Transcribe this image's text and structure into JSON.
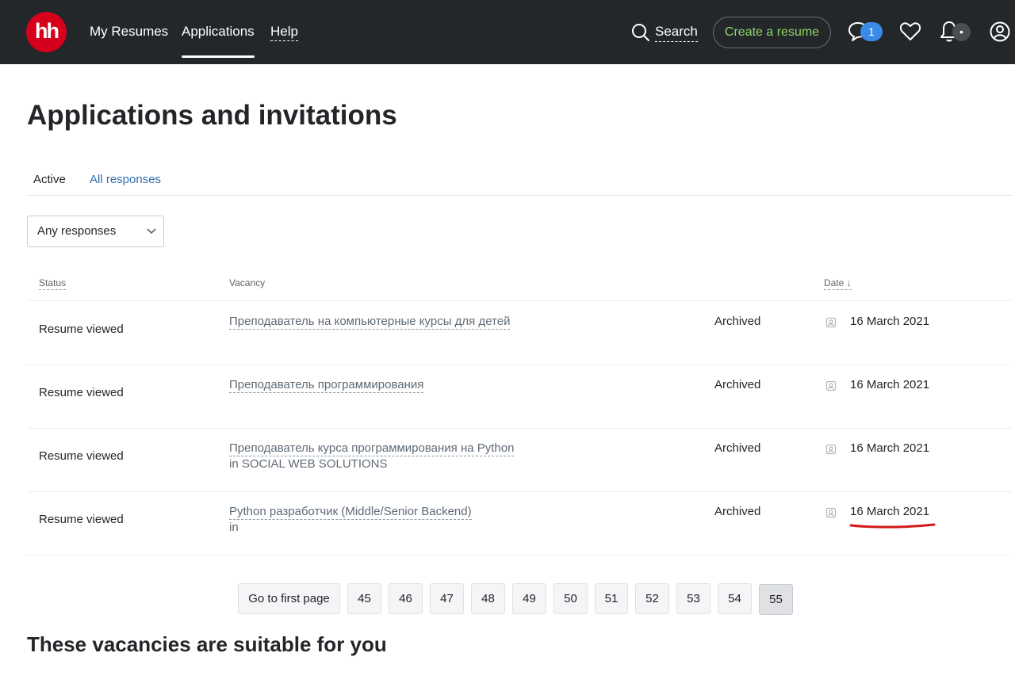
{
  "header": {
    "logo_text": "hh",
    "nav": [
      "My Resumes",
      "Applications",
      "Help"
    ],
    "search_label": "Search",
    "create_resume_label": "Create a resume",
    "messages_badge": "1",
    "notifications_badge": "•",
    "brand_color": "#d6001c",
    "accent_green": "#8fd66a"
  },
  "page_title": "Applications and invitations",
  "tabs": [
    "Active",
    "All responses"
  ],
  "filter": {
    "selected": "Any responses"
  },
  "table": {
    "headers": {
      "status": "Status",
      "vacancy": "Vacancy",
      "date": "Date ↓"
    },
    "rows": [
      {
        "status": "Resume viewed",
        "vacancy": "Преподаватель на компьютерные курсы для детей",
        "company": "",
        "state": "Archived",
        "date": "16 March 2021"
      },
      {
        "status": "Resume viewed",
        "vacancy": "Преподаватель программирования",
        "company": "",
        "state": "Archived",
        "date": "16 March 2021"
      },
      {
        "status": "Resume viewed",
        "vacancy": "Преподаватель курса программирования на Python",
        "company": "in SOCIAL WEB SOLUTIONS",
        "state": "Archived",
        "date": "16 March 2021"
      },
      {
        "status": "Resume viewed",
        "vacancy": "Python разработчик (Middle/Senior Backend)",
        "company": "in",
        "state": "Archived",
        "date": "16 March 2021"
      }
    ]
  },
  "pagination": {
    "first_label": "Go to first page",
    "pages": [
      "45",
      "46",
      "47",
      "48",
      "49",
      "50",
      "51",
      "52",
      "53",
      "54",
      "55"
    ],
    "current": "55"
  },
  "suggested_title": "These vacancies are suitable for you"
}
